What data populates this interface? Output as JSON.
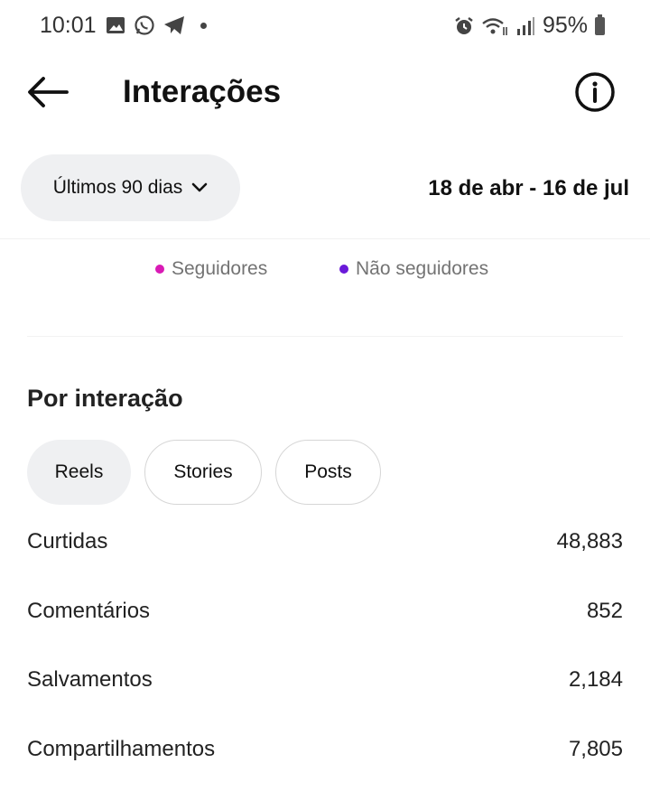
{
  "status_bar": {
    "time": "10:01",
    "battery": "95%"
  },
  "header": {
    "title": "Interações"
  },
  "filter": {
    "range_label": "Últimos 90 dias",
    "date_range": "18 de abr - 16 de jul"
  },
  "legend": [
    {
      "label": "Seguidores",
      "color": "#d91ab5"
    },
    {
      "label": "Não seguidores",
      "color": "#6a1ad9"
    }
  ],
  "section": {
    "title": "Por interação",
    "tabs": [
      {
        "label": "Reels",
        "active": true
      },
      {
        "label": "Stories",
        "active": false
      },
      {
        "label": "Posts",
        "active": false
      }
    ],
    "rows": [
      {
        "label": "Curtidas",
        "value": "48,883"
      },
      {
        "label": "Comentários",
        "value": "852"
      },
      {
        "label": "Salvamentos",
        "value": "2,184"
      },
      {
        "label": "Compartilhamentos",
        "value": "7,805"
      }
    ]
  },
  "icons": {
    "status_left": [
      "image-icon",
      "whatsapp-icon",
      "telegram-icon",
      "dot-icon"
    ],
    "status_right": [
      "alarm-icon",
      "wifi-icon",
      "signal-icon",
      "battery-icon"
    ],
    "header": [
      "back-arrow-icon",
      "info-icon"
    ],
    "filter": [
      "chevron-down-icon"
    ]
  }
}
